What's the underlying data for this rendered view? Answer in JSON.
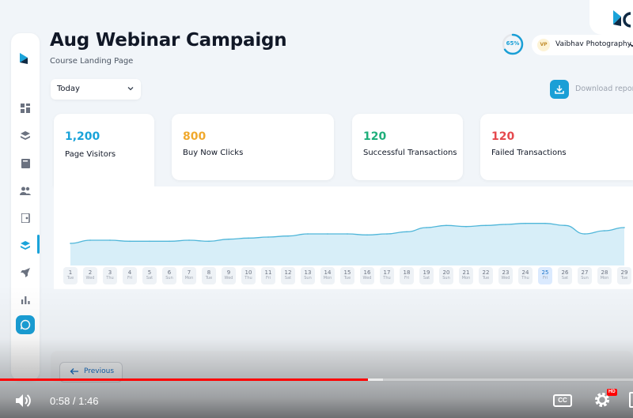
{
  "page": {
    "title": "Aug Webinar Campaign",
    "subtitle": "Course Landing Page"
  },
  "filters": {
    "date_range": "Today"
  },
  "header": {
    "progress_label": "65%",
    "progress_value": 0.65,
    "user_initials": "VP",
    "user_name": "Vaibhav Photography"
  },
  "actions": {
    "download_label": "Download report"
  },
  "stats": [
    {
      "value": "1,200",
      "label": "Page Visitors",
      "color": "#1aa3d9"
    },
    {
      "value": "800",
      "label": "Buy Now Clicks",
      "color": "#f0a92e"
    },
    {
      "value": "120",
      "label": "Successful Transactions",
      "color": "#1eae7a"
    },
    {
      "value": "120",
      "label": "Failed Transactions",
      "color": "#e5484d"
    }
  ],
  "chart_data": {
    "type": "area",
    "x": [
      "1",
      "2",
      "3",
      "4",
      "5",
      "6",
      "7",
      "8",
      "9",
      "10",
      "11",
      "12",
      "13",
      "14",
      "15",
      "16",
      "17",
      "18",
      "19",
      "20",
      "21",
      "22",
      "23",
      "24",
      "25",
      "26",
      "27",
      "28",
      "29"
    ],
    "weekdays": [
      "Tue",
      "Wed",
      "Thu",
      "Fri",
      "Sat",
      "Sun",
      "Mon",
      "Tue",
      "Wed",
      "Thu",
      "Fri",
      "Sat",
      "Sun",
      "Mon",
      "Tue",
      "Wed",
      "Thu",
      "Fri",
      "Sat",
      "Sun",
      "Mon",
      "Tue",
      "Wed",
      "Thu",
      "Fri",
      "Sat",
      "Sun",
      "Mon",
      "Tue"
    ],
    "highlighted_day": "25",
    "series": [
      {
        "values": [
          18,
          21,
          21,
          20,
          20,
          20,
          21,
          20,
          22,
          23,
          24,
          25,
          27,
          27,
          27,
          26,
          27,
          29,
          33,
          35,
          34,
          35,
          36,
          37,
          37,
          35,
          27,
          30,
          33
        ]
      }
    ],
    "ylim": [
      0,
      60
    ],
    "line_color": "#4fb6d9",
    "fill_color": "#d7eef8",
    "grid": false
  },
  "pagination": {
    "previous_label": "Previous"
  },
  "player": {
    "time": "0:58 / 1:46",
    "played_fraction": 0.581,
    "buffered_fraction": 0.605,
    "cc_label": "CC",
    "hd_label": "HD"
  }
}
